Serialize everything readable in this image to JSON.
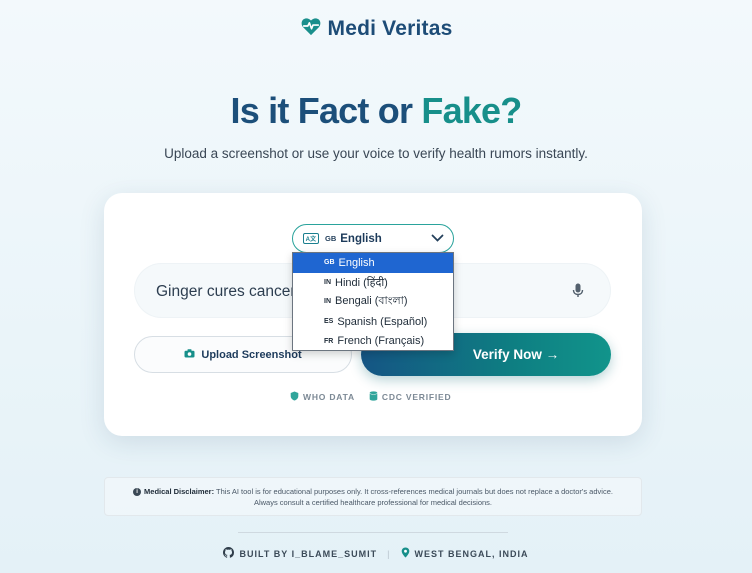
{
  "brand": {
    "name": "Medi Veritas",
    "icon": "heart-pulse-icon",
    "color": "#1d4c77"
  },
  "hero": {
    "title_part1": "Is it Fact or",
    "title_part2": "Fake?",
    "subtitle": "Upload a screenshot or use your voice to verify health rumors instantly."
  },
  "language": {
    "selected_flag": "GB",
    "selected_label": "English",
    "options": [
      {
        "flag": "GB",
        "label": "English"
      },
      {
        "flag": "IN",
        "label": "Hindi (हिंदी)"
      },
      {
        "flag": "IN",
        "label": "Bengali (বাংলা)"
      },
      {
        "flag": "ES",
        "label": "Spanish (Español)"
      },
      {
        "flag": "FR",
        "label": "French (Français)"
      }
    ]
  },
  "query": {
    "value": "Ginger cures cancer"
  },
  "actions": {
    "upload_label": "Upload Screenshot",
    "verify_label": "Verify Now →"
  },
  "badges": {
    "who": "WHO DATA",
    "cdc": "CDC VERIFIED"
  },
  "disclaimer": {
    "label": "Medical Disclaimer:",
    "line1": "This AI tool is for educational purposes only. It cross-references medical journals but does not replace a doctor's advice.",
    "line2": "Always consult a certified healthcare professional for medical decisions."
  },
  "footer": {
    "author": "BUILT BY I_BLAME_SUMIT",
    "location": "WEST BENGAL, INDIA"
  },
  "colors": {
    "accent": "#178f8a",
    "primary": "#1c4f7a",
    "selected": "#1f66d1"
  }
}
